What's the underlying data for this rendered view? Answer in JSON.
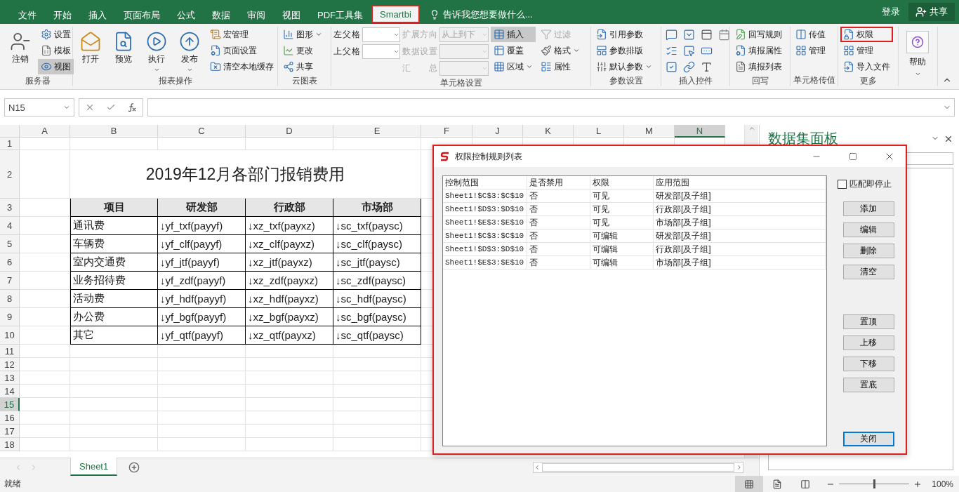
{
  "tabs": [
    {
      "label": "文件",
      "selected": false,
      "marked": false
    },
    {
      "label": "开始",
      "selected": false,
      "marked": false
    },
    {
      "label": "插入",
      "selected": false,
      "marked": false
    },
    {
      "label": "页面布局",
      "selected": false,
      "marked": false
    },
    {
      "label": "公式",
      "selected": false,
      "marked": false
    },
    {
      "label": "数据",
      "selected": false,
      "marked": false
    },
    {
      "label": "审阅",
      "selected": false,
      "marked": false
    },
    {
      "label": "视图",
      "selected": false,
      "marked": false
    },
    {
      "label": "PDF工具集",
      "selected": false,
      "marked": false
    },
    {
      "label": "Smartbi",
      "selected": true,
      "marked": true
    }
  ],
  "tell_me": {
    "placeholder": "告诉我您想要做什么..."
  },
  "account": {
    "sign_in": "登录",
    "share": "共享"
  },
  "ribbon": {
    "groups": [
      {
        "label": "服务器",
        "columns": [
          [
            {
              "label": "注销",
              "kind": "large",
              "on": false,
              "disabled": false,
              "marked": false
            }
          ],
          [
            {
              "label": "设置",
              "kind": "small",
              "on": false,
              "disabled": false,
              "marked": false
            },
            {
              "label": "模板",
              "kind": "small",
              "on": false,
              "disabled": false,
              "marked": false
            },
            {
              "label": "视图",
              "kind": "small",
              "on": true,
              "disabled": false,
              "marked": false
            }
          ]
        ]
      },
      {
        "label": "报表操作",
        "columns": [
          [
            {
              "label": "打开",
              "kind": "large",
              "on": false,
              "disabled": false,
              "marked": false
            }
          ],
          [
            {
              "label": "预览",
              "kind": "large",
              "on": false,
              "disabled": false,
              "marked": false
            }
          ],
          [
            {
              "label": "执行",
              "kind": "large-menu",
              "on": false,
              "disabled": false,
              "marked": false
            }
          ],
          [
            {
              "label": "发布",
              "kind": "large-menu",
              "on": false,
              "disabled": false,
              "marked": false
            }
          ],
          [
            {
              "label": "宏管理",
              "kind": "small",
              "on": false,
              "disabled": false,
              "marked": false
            },
            {
              "label": "页面设置",
              "kind": "small",
              "on": false,
              "disabled": false,
              "marked": false
            },
            {
              "label": "清空本地缓存",
              "kind": "small",
              "on": false,
              "disabled": false,
              "marked": false
            }
          ]
        ]
      },
      {
        "label": "云图表",
        "columns": [
          [
            {
              "label": "图形",
              "kind": "small-menu",
              "on": false,
              "disabled": false,
              "marked": false
            },
            {
              "label": "更改",
              "kind": "small",
              "on": false,
              "disabled": false,
              "marked": false
            },
            {
              "label": "共享",
              "kind": "small",
              "on": false,
              "disabled": false,
              "marked": false
            }
          ]
        ]
      },
      {
        "label": "单元格设置",
        "columns": [
          [
            {
              "label": "左父格",
              "kind": "combo",
              "disabled": false
            },
            {
              "label": "上父格",
              "kind": "combo",
              "disabled": false
            }
          ],
          [
            {
              "label": "扩展方向",
              "kind": "combo",
              "disabled": true,
              "value": "从上到下"
            },
            {
              "label": "数据设置",
              "kind": "combo",
              "disabled": true
            },
            {
              "label": "汇 总",
              "kind": "combo",
              "disabled": true
            }
          ],
          [
            {
              "label": "插入",
              "kind": "small",
              "on": true,
              "disabled": false,
              "marked": false
            },
            {
              "label": "覆盖",
              "kind": "small",
              "on": false,
              "disabled": false,
              "marked": false
            },
            {
              "label": "区域",
              "kind": "small-menu",
              "on": false,
              "disabled": false,
              "marked": false
            }
          ],
          [
            {
              "label": "过滤",
              "kind": "small",
              "on": false,
              "disabled": true,
              "marked": false
            },
            {
              "label": "格式",
              "kind": "small-menu",
              "on": false,
              "disabled": false,
              "marked": false
            },
            {
              "label": "属性",
              "kind": "small",
              "on": false,
              "disabled": false,
              "marked": false
            }
          ]
        ]
      },
      {
        "label": "参数设置",
        "columns": [
          [
            {
              "label": "引用参数",
              "kind": "small",
              "on": false,
              "disabled": false,
              "marked": false
            },
            {
              "label": "参数排版",
              "kind": "small",
              "on": false,
              "disabled": false,
              "marked": false
            },
            {
              "label": "默认参数",
              "kind": "small-menu",
              "on": false,
              "disabled": false,
              "marked": false
            }
          ]
        ]
      },
      {
        "label": "插入控件",
        "columns": [
          [
            {
              "kind": "icon",
              "on": false,
              "disabled": false,
              "marked": false
            },
            {
              "kind": "icon",
              "on": false,
              "disabled": false,
              "marked": false
            },
            {
              "kind": "icon",
              "on": false,
              "disabled": false,
              "marked": false
            }
          ],
          [
            {
              "kind": "icon",
              "on": false,
              "disabled": false,
              "marked": false
            },
            {
              "kind": "icon",
              "on": false,
              "disabled": false,
              "marked": false
            },
            {
              "kind": "icon",
              "on": false,
              "disabled": false,
              "marked": false
            }
          ],
          [
            {
              "kind": "icon",
              "on": false,
              "disabled": false,
              "marked": false
            },
            {
              "kind": "icon",
              "on": false,
              "disabled": false,
              "marked": false
            },
            {
              "kind": "icon",
              "on": false,
              "disabled": false,
              "marked": false
            }
          ],
          [
            {
              "kind": "icon",
              "on": false,
              "disabled": false,
              "marked": false
            }
          ]
        ]
      },
      {
        "label": "回写",
        "columns": [
          [
            {
              "label": "回写规则",
              "kind": "small",
              "on": false,
              "disabled": false,
              "marked": false
            },
            {
              "label": "填报属性",
              "kind": "small",
              "on": false,
              "disabled": false,
              "marked": false
            },
            {
              "label": "填报列表",
              "kind": "small",
              "on": false,
              "disabled": false,
              "marked": false
            }
          ]
        ]
      },
      {
        "label": "单元格传值",
        "columns": [
          [
            {
              "label": "传值",
              "kind": "small",
              "on": false,
              "disabled": false,
              "marked": false
            },
            {
              "label": "管理",
              "kind": "small",
              "on": false,
              "disabled": false,
              "marked": false
            }
          ]
        ]
      },
      {
        "label": "更多",
        "columns": [
          [
            {
              "label": "权限",
              "kind": "small",
              "on": false,
              "disabled": false,
              "marked": true
            },
            {
              "label": "管理",
              "kind": "small",
              "on": false,
              "disabled": false,
              "marked": false
            },
            {
              "label": "导入文件",
              "kind": "small",
              "on": false,
              "disabled": false,
              "marked": false
            }
          ]
        ]
      },
      {
        "columns": [
          [
            {
              "label": "帮助",
              "kind": "help",
              "on": false,
              "disabled": false,
              "marked": false
            }
          ]
        ]
      }
    ]
  },
  "formula_bar": {
    "name_box": "N15"
  },
  "sheet": {
    "columns": [
      {
        "label": "A",
        "selected": false
      },
      {
        "label": "B",
        "selected": false
      },
      {
        "label": "C",
        "selected": false
      },
      {
        "label": "D",
        "selected": false
      },
      {
        "label": "E",
        "selected": false
      },
      {
        "label": "F",
        "selected": false
      },
      {
        "label": "J",
        "selected": false
      },
      {
        "label": "K",
        "selected": false
      },
      {
        "label": "L",
        "selected": false
      },
      {
        "label": "M",
        "selected": false
      },
      {
        "label": "N",
        "selected": true
      }
    ],
    "rows": [
      {
        "label": "1",
        "selected": false
      },
      {
        "label": "2",
        "selected": false
      },
      {
        "label": "3",
        "selected": false
      },
      {
        "label": "4",
        "selected": false
      },
      {
        "label": "5",
        "selected": false
      },
      {
        "label": "6",
        "selected": false
      },
      {
        "label": "7",
        "selected": false
      },
      {
        "label": "8",
        "selected": false
      },
      {
        "label": "9",
        "selected": false
      },
      {
        "label": "10",
        "selected": false
      },
      {
        "label": "11",
        "selected": false
      },
      {
        "label": "12",
        "selected": false
      },
      {
        "label": "13",
        "selected": false
      },
      {
        "label": "14",
        "selected": false
      },
      {
        "label": "15",
        "selected": true
      },
      {
        "label": "16",
        "selected": false
      },
      {
        "label": "17",
        "selected": false
      },
      {
        "label": "18",
        "selected": false
      }
    ],
    "title": "2019年12月各部门报销费用",
    "table_header": [
      "项目",
      "研发部",
      "行政部",
      "市场部"
    ],
    "table_rows": [
      [
        "通讯费",
        "↓yf_txf(payyf)",
        "↓xz_txf(payxz)",
        "↓sc_txf(paysc)"
      ],
      [
        "车辆费",
        "↓yf_clf(payyf)",
        "↓xz_clf(payxz)",
        "↓sc_clf(paysc)"
      ],
      [
        "室内交通费",
        "↓yf_jtf(payyf)",
        "↓xz_jtf(payxz)",
        "↓sc_jtf(paysc)"
      ],
      [
        "业务招待费",
        "↓yf_zdf(payyf)",
        "↓xz_zdf(payxz)",
        "↓sc_zdf(paysc)"
      ],
      [
        "活动费",
        "↓yf_hdf(payyf)",
        "↓xz_hdf(payxz)",
        "↓sc_hdf(paysc)"
      ],
      [
        "办公费",
        "↓yf_bgf(payyf)",
        "↓xz_bgf(payxz)",
        "↓sc_bgf(paysc)"
      ],
      [
        "其它",
        "↓yf_qtf(payyf)",
        "↓xz_qtf(payxz)",
        "↓sc_qtf(paysc)"
      ]
    ]
  },
  "sheet_tabs": [
    {
      "label": "Sheet1",
      "selected": true
    }
  ],
  "side_panel": {
    "title": "数据集面板"
  },
  "dialog": {
    "title": "权限控制规则列表",
    "columns": [
      "控制范围",
      "是否禁用",
      "权限",
      "应用范围"
    ],
    "rows": [
      [
        "Sheet1!$C$3:$C$10",
        "否",
        "可见",
        "研发部[及子组]"
      ],
      [
        "Sheet1!$D$3:$D$10",
        "否",
        "可见",
        "行政部[及子组]"
      ],
      [
        "Sheet1!$E$3:$E$10",
        "否",
        "可见",
        "市场部[及子组]"
      ],
      [
        "Sheet1!$C$3:$C$10",
        "否",
        "可编辑",
        "研发部[及子组]"
      ],
      [
        "Sheet1!$D$3:$D$10",
        "否",
        "可编辑",
        "行政部[及子组]"
      ],
      [
        "Sheet1!$E$3:$E$10",
        "否",
        "可编辑",
        "市场部[及子组]"
      ]
    ],
    "stop_on_match": {
      "label": "匹配即停止",
      "checked": false
    },
    "button_groups": [
      [
        "添加",
        "编辑",
        "删除",
        "清空"
      ],
      [
        "置顶",
        "上移",
        "下移",
        "置底"
      ],
      [
        "关闭"
      ]
    ]
  },
  "status_bar": {
    "text": "就绪",
    "views": [
      {
        "selected": true
      },
      {
        "selected": false
      },
      {
        "selected": false
      }
    ],
    "zoom": {
      "level": 0.5
    },
    "zoom_text": "100%"
  }
}
